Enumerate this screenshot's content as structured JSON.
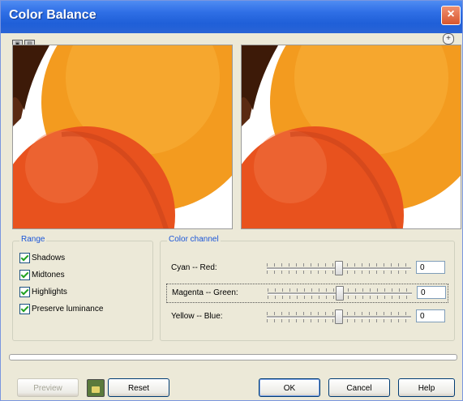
{
  "window": {
    "title": "Color Balance"
  },
  "range": {
    "label": "Range",
    "items": [
      {
        "label": "Shadows",
        "checked": true
      },
      {
        "label": "Midtones",
        "checked": true
      },
      {
        "label": "Highlights",
        "checked": true
      },
      {
        "label": "Preserve luminance",
        "checked": true
      }
    ]
  },
  "color_channel": {
    "label": "Color channel",
    "channels": [
      {
        "label": "Cyan -- Red:",
        "value": "0",
        "slider_fraction": 0.5
      },
      {
        "label": "Magenta -- Green:",
        "value": "0",
        "slider_fraction": 0.5
      },
      {
        "label": "Yellow -- Blue:",
        "value": "0",
        "slider_fraction": 0.5
      }
    ]
  },
  "buttons": {
    "preview": "Preview",
    "reset": "Reset",
    "ok": "OK",
    "cancel": "Cancel",
    "help": "Help"
  },
  "icons": {
    "close": "close-icon",
    "expand": "expand-icon",
    "lock": "lock-icon"
  },
  "colors": {
    "title_bar": "#2f6fe6",
    "accent_label": "#1b56d8",
    "orange_fruit": "#f39b1f",
    "red_fruit": "#e8521e"
  }
}
